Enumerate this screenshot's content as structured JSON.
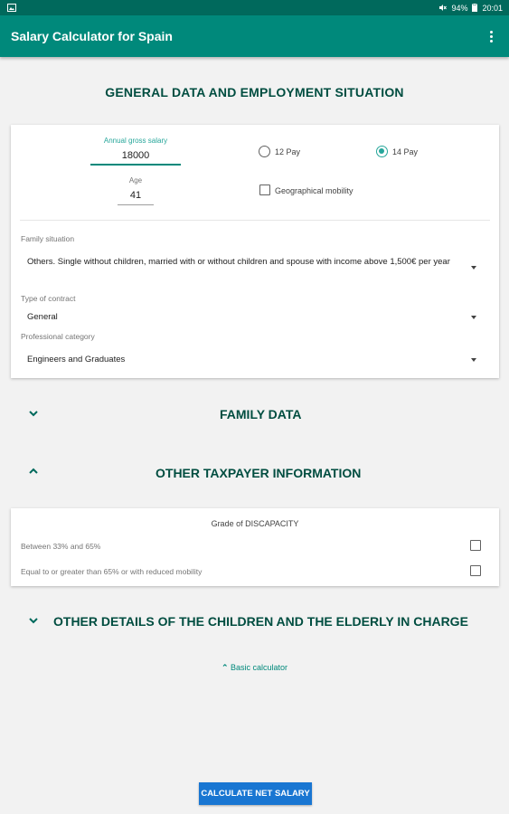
{
  "status_bar": {
    "battery": "94%",
    "time": "20:01"
  },
  "app_bar": {
    "title": "Salary Calculator for Spain"
  },
  "general": {
    "title": "GENERAL DATA AND EMPLOYMENT SITUATION",
    "salary_label": "Annual gross salary",
    "salary_value": "18000",
    "age_label": "Age",
    "age_value": "41",
    "pay_12_label": "12 Pay",
    "pay_14_label": "14 Pay",
    "pay_selected": "14 Pay",
    "mobility_label": "Geographical mobility",
    "mobility_checked": false,
    "family_situation_label": "Family situation",
    "family_situation_value": "Others. Single without children, married with or without children and spouse with income above 1,500€ per year",
    "contract_label": "Type of contract",
    "contract_value": "General",
    "category_label": "Professional category",
    "category_value": "Engineers and Graduates"
  },
  "family_data": {
    "title": "FAMILY DATA",
    "expanded": false
  },
  "other_taxpayer": {
    "title": "OTHER TAXPAYER INFORMATION",
    "expanded": true,
    "disability_heading": "Grade of DISCAPACITY",
    "option_1": "Between 33% and 65%",
    "option_2": "Equal to or greater than 65% or with reduced mobility"
  },
  "children_elderly": {
    "title": "OTHER DETAILS OF THE CHILDREN AND THE ELDERLY IN CHARGE",
    "expanded": false
  },
  "basic_calculator_link": "Basic calculator",
  "calculate_button": "CALCULATE NET SALARY",
  "colors": {
    "primary": "#00897b",
    "primary_dark": "#00695c",
    "button": "#1976d2"
  }
}
